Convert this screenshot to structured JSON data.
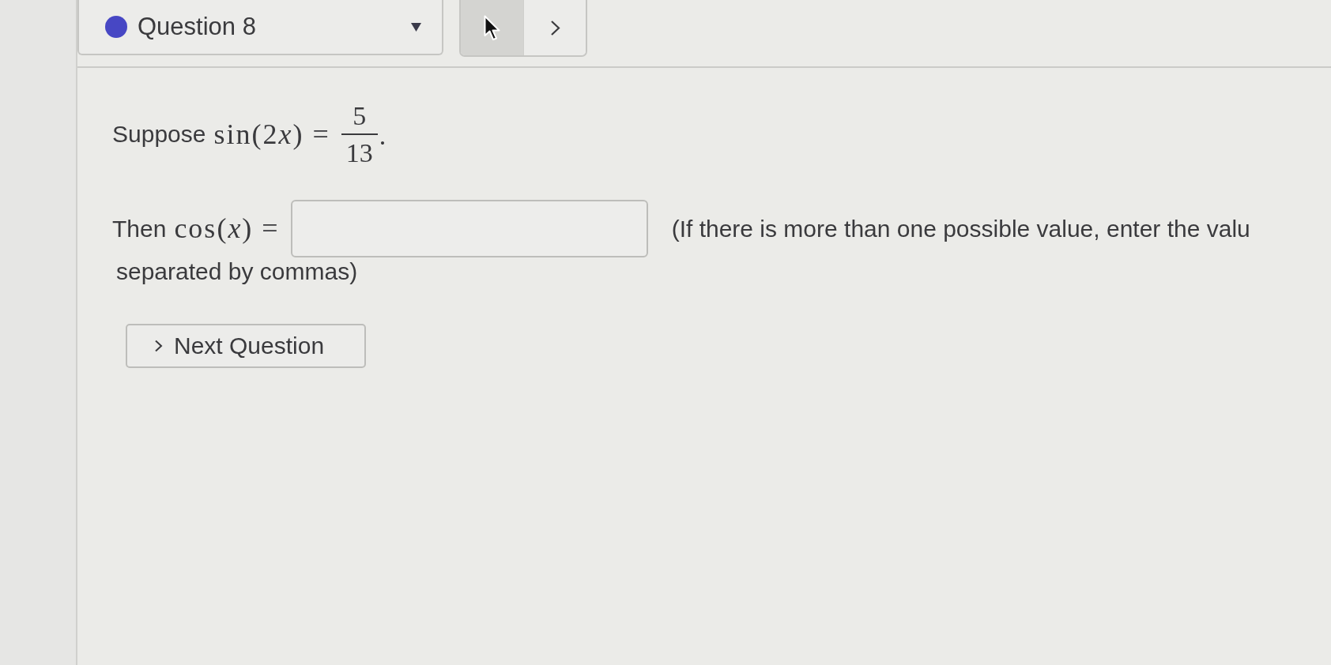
{
  "question_selector": {
    "label": "Question 8"
  },
  "nav_buttons": [
    {
      "kind": "previous",
      "hovered": true
    },
    {
      "kind": "next",
      "hovered": false
    }
  ],
  "statement": {
    "lead": "Suppose",
    "expression": [
      {
        "text": "sin(2",
        "italic": false
      },
      {
        "text": "x",
        "italic": true
      },
      {
        "text": ") =",
        "italic": false
      }
    ],
    "fraction": {
      "numerator": "5",
      "denominator": "13"
    },
    "trail": "."
  },
  "answer": {
    "lead": "Then",
    "expression": [
      {
        "text": "cos(",
        "italic": false
      },
      {
        "text": "x",
        "italic": true
      },
      {
        "text": ") =",
        "italic": false
      }
    ],
    "note_lines": [
      "(If there is more than one possible value, enter the valu",
      "separated by commas)"
    ]
  },
  "next_question_button": {
    "label": "Next Question"
  }
}
